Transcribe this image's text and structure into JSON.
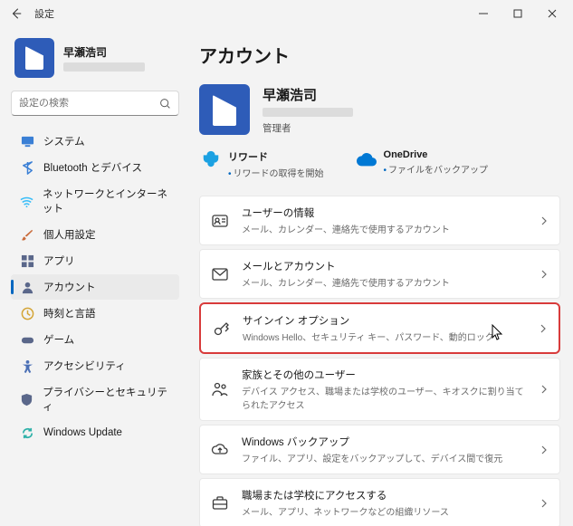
{
  "titlebar": {
    "title": "設定"
  },
  "sidebar": {
    "account": {
      "name": "早瀬浩司"
    },
    "search_placeholder": "設定の検索",
    "items": [
      {
        "label": "システム",
        "icon": "display",
        "color": "#3a7fd5"
      },
      {
        "label": "Bluetooth とデバイス",
        "icon": "bluetooth",
        "color": "#3a7fd5"
      },
      {
        "label": "ネットワークとインターネット",
        "icon": "wifi",
        "color": "#38bdf8"
      },
      {
        "label": "個人用設定",
        "icon": "brush",
        "color": "#c96a3a"
      },
      {
        "label": "アプリ",
        "icon": "apps",
        "color": "#5a678a"
      },
      {
        "label": "アカウント",
        "icon": "person",
        "color": "#5a678a",
        "selected": true
      },
      {
        "label": "時刻と言語",
        "icon": "clock",
        "color": "#d4a537"
      },
      {
        "label": "ゲーム",
        "icon": "gamepad",
        "color": "#5a678a"
      },
      {
        "label": "アクセシビリティ",
        "icon": "accessibility",
        "color": "#4a6fb5"
      },
      {
        "label": "プライバシーとセキュリティ",
        "icon": "shield",
        "color": "#5a678a"
      },
      {
        "label": "Windows Update",
        "icon": "update",
        "color": "#2eb1a8"
      }
    ]
  },
  "main": {
    "page_title": "アカウント",
    "account": {
      "name": "早瀬浩司",
      "role": "管理者"
    },
    "status": {
      "rewards": {
        "label": "リワード",
        "sub": "リワードの取得を開始"
      },
      "onedrive": {
        "label": "OneDrive",
        "sub": "ファイルをバックアップ"
      }
    },
    "cards": [
      {
        "id": "user-info",
        "title": "ユーザーの情報",
        "sub": "メール、カレンダー、連絡先で使用するアカウント",
        "icon": "user-card"
      },
      {
        "id": "email-accounts",
        "title": "メールとアカウント",
        "sub": "メール、カレンダー、連絡先で使用するアカウント",
        "icon": "mail"
      },
      {
        "id": "signin-options",
        "title": "サインイン オプション",
        "sub": "Windows Hello、セキュリティ キー、パスワード、動的ロック",
        "icon": "key",
        "highlight": true
      },
      {
        "id": "family",
        "title": "家族とその他のユーザー",
        "sub": "デバイス アクセス、職場または学校のユーザー、キオスクに割り当てられたアクセス",
        "icon": "family"
      },
      {
        "id": "backup",
        "title": "Windows バックアップ",
        "sub": "ファイル、アプリ、設定をバックアップして、デバイス間で復元",
        "icon": "backup"
      },
      {
        "id": "work-school",
        "title": "職場または学校にアクセスする",
        "sub": "メール、アプリ、ネットワークなどの組織リソース",
        "icon": "briefcase"
      }
    ]
  }
}
